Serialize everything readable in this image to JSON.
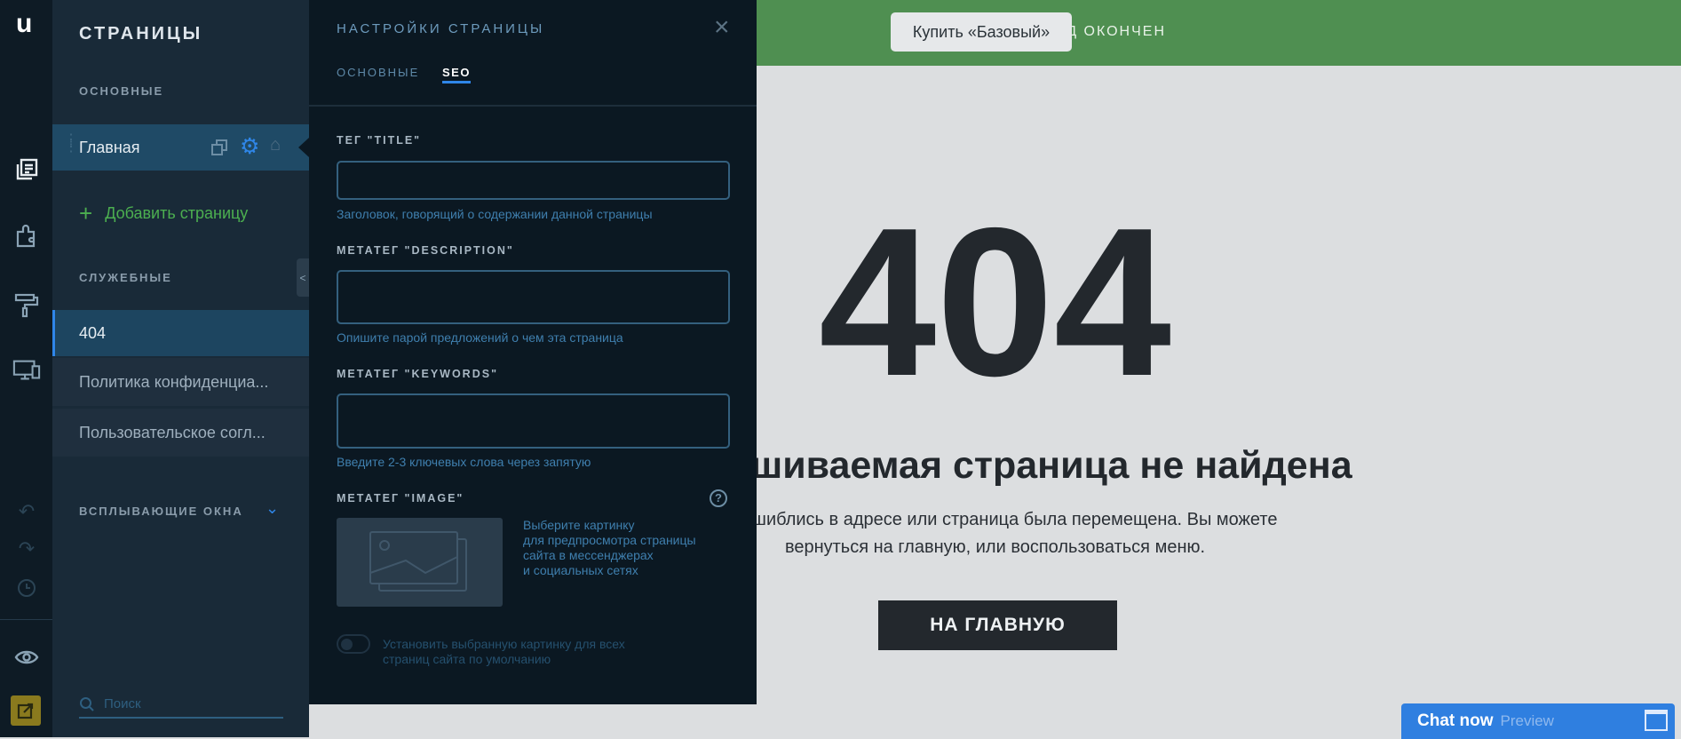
{
  "rail": {
    "logo": "u",
    "icons": [
      "pages-icon",
      "plugins-icon",
      "design-roller-icon",
      "devices-icon",
      "undo-icon",
      "redo-icon",
      "history-icon",
      "preview-eye-icon",
      "publish-icon"
    ]
  },
  "pages": {
    "title": "СТРАНИЦЫ",
    "main_section": "ОСНОВНЫЕ",
    "main_items": [
      {
        "label": "Главная"
      }
    ],
    "add_page": "Добавить страницу",
    "service_section": "СЛУЖЕБНЫЕ",
    "service_items": [
      {
        "label": "404"
      },
      {
        "label": "Политика конфиденциа..."
      },
      {
        "label": "Пользовательское согл..."
      }
    ],
    "popups_section": "ВСПЛЫВАЮЩИЕ ОКНА",
    "search_placeholder": "Поиск"
  },
  "settings": {
    "title": "НАСТРОЙКИ СТРАНИЦЫ",
    "tabs": [
      {
        "label": "ОСНОВНЫЕ",
        "active": false
      },
      {
        "label": "SEO",
        "active": true
      }
    ],
    "title_label": "ТЕГ \"TITLE\"",
    "title_value": "",
    "title_hint": "Заголовок, говорящий о содержании данной страницы",
    "desc_label": "МЕТАТЕГ \"DESCRIPTION\"",
    "desc_value": "",
    "desc_hint": "Опишите парой предложений о чем эта страница",
    "kw_label": "МЕТАТЕГ \"KEYWORDS\"",
    "kw_value": "",
    "kw_hint": "Введите 2-3 ключевых слова через запятую",
    "image_label": "МЕТАТЕГ \"IMAGE\"",
    "image_text": [
      "Выберите картинку",
      "для предпросмотра страницы",
      "сайта в мессенджерах",
      "и социальных сетях"
    ],
    "toggle_text": [
      "Установить выбранную картинку для всех",
      "страниц сайта по умолчанию"
    ],
    "toggle_on": false
  },
  "preview": {
    "banner_text": "ПРОБНЫЙ ПЕРИОД ОКОНЧЕН",
    "banner_button": "Купить «Базовый»",
    "code": "404",
    "heading": "Запрашиваемая страница не найдена",
    "text_line1": "Вы ошиблись в адресе или страница была перемещена. Вы можете",
    "text_line2": "вернуться на главную, или воспользоваться меню.",
    "home_button": "НА ГЛАВНУЮ",
    "chat_label": "Chat now",
    "chat_sub": "Preview"
  },
  "colors": {
    "accent": "#2f7fe0",
    "green": "#4f8f51",
    "add": "#4caf50"
  }
}
